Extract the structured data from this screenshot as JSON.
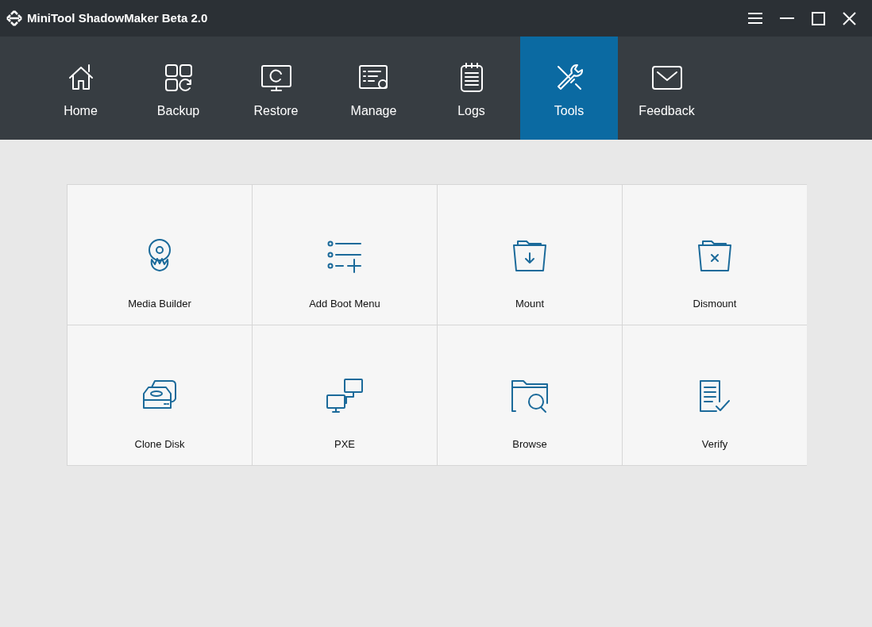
{
  "window": {
    "title": "MiniTool ShadowMaker Beta 2.0"
  },
  "nav": [
    {
      "label": "Home",
      "selected": false
    },
    {
      "label": "Backup",
      "selected": false
    },
    {
      "label": "Restore",
      "selected": false
    },
    {
      "label": "Manage",
      "selected": false
    },
    {
      "label": "Logs",
      "selected": false
    },
    {
      "label": "Tools",
      "selected": true
    },
    {
      "label": "Feedback",
      "selected": false
    }
  ],
  "tools": [
    {
      "label": "Media Builder"
    },
    {
      "label": "Add Boot Menu"
    },
    {
      "label": "Mount"
    },
    {
      "label": "Dismount"
    },
    {
      "label": "Clone Disk"
    },
    {
      "label": "PXE"
    },
    {
      "label": "Browse"
    },
    {
      "label": "Verify"
    }
  ]
}
